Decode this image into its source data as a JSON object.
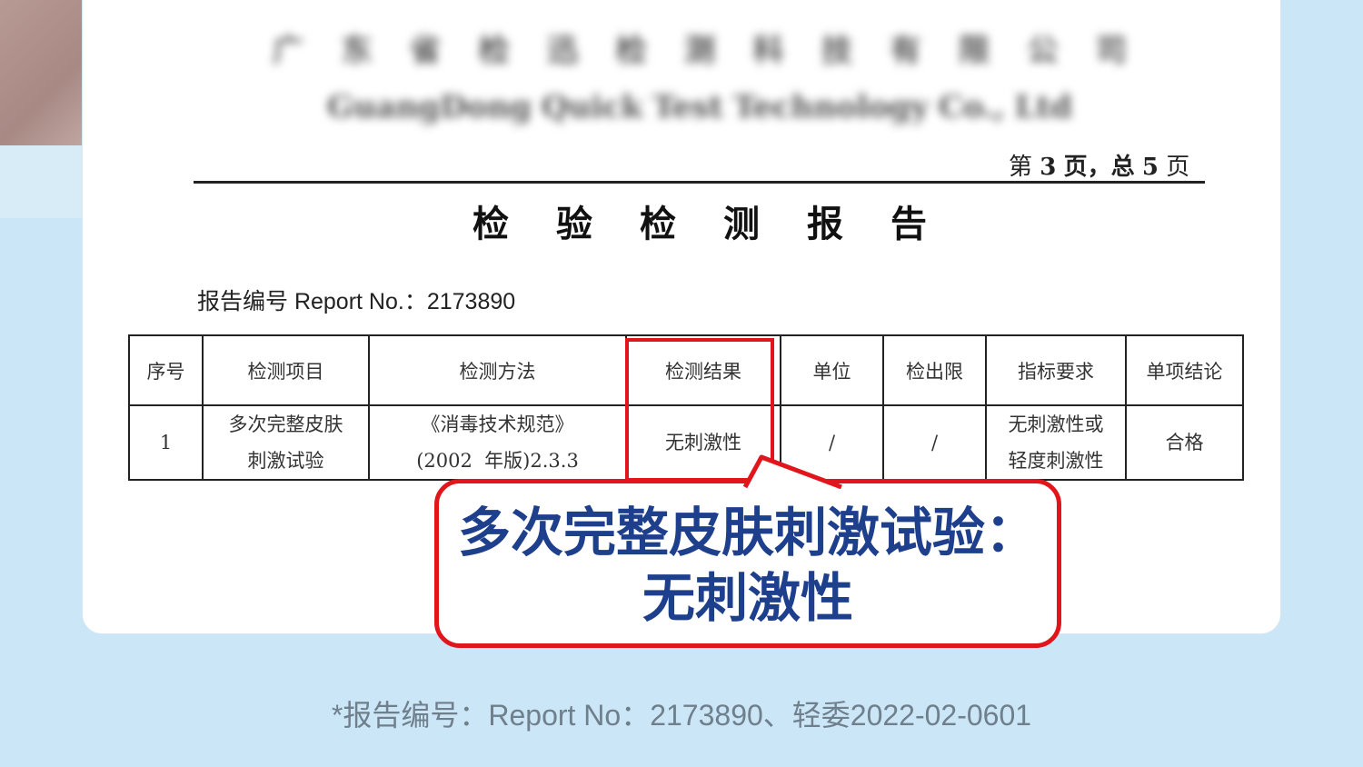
{
  "document": {
    "company_name_cn": [
      "广",
      "东",
      "省",
      "检",
      "迅",
      "检",
      "测",
      "科",
      "技",
      "有",
      "限",
      "公",
      "司"
    ],
    "company_name_en": [
      "GuangDong",
      "Quick",
      "Test",
      "Technology",
      "Co.,",
      "Ltd"
    ],
    "page_indicator": {
      "prefix": "第",
      "current": "3",
      "middle": "页，总",
      "total": "5",
      "suffix": "页"
    },
    "title_chars": [
      "检",
      "验",
      "检",
      "测",
      "报",
      "告"
    ],
    "report_number": "报告编号 Report No.：2173890"
  },
  "results_table": {
    "headers": [
      "序号",
      "检测项目",
      "检测方法",
      "检测结果",
      "单位",
      "检出限",
      "指标要求",
      "单项结论"
    ],
    "rows": [
      {
        "index": "1",
        "item": [
          "多次完整皮肤",
          "刺激试验"
        ],
        "method": [
          "《消毒技术规范》",
          "(2002  年版)2.3.3"
        ],
        "result": "无刺激性",
        "unit": "/",
        "detection_limit": "/",
        "requirement": [
          "无刺激性或",
          "轻度刺激性"
        ],
        "conclusion": "合格"
      }
    ]
  },
  "callout": {
    "line1": "多次完整皮肤刺激试验：",
    "line2": "无刺激性"
  },
  "footnote": "*报告编号：Report No：2173890、轻委2022-02-0601",
  "colors": {
    "background": "#cbe6f7",
    "highlight_red": "#e0161c",
    "callout_text_blue": "#1e3f8c"
  }
}
